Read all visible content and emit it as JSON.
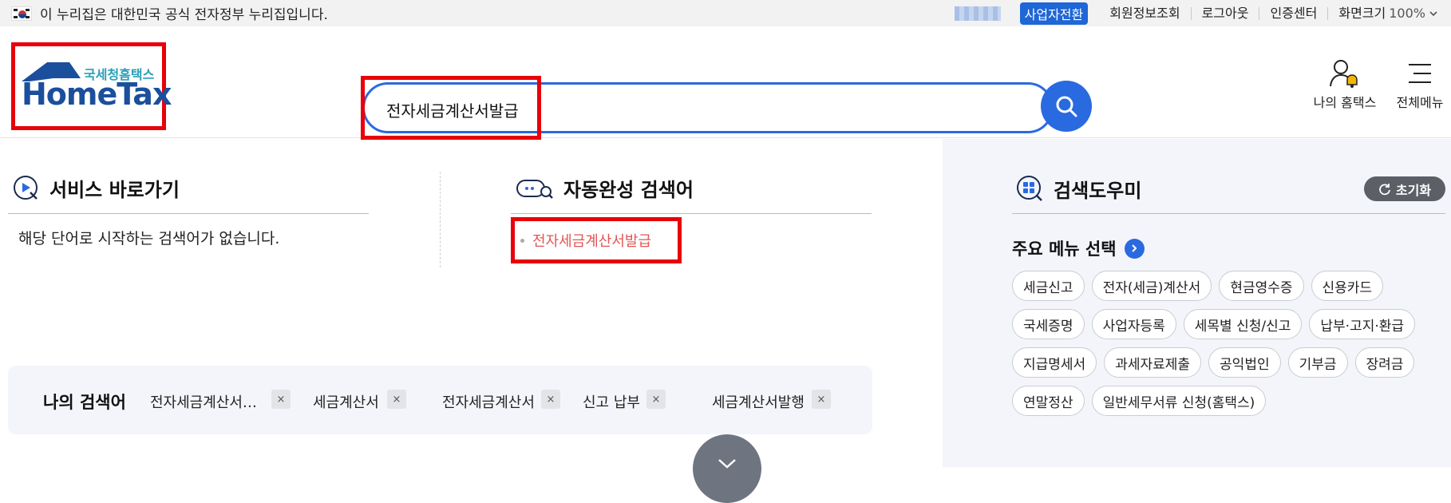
{
  "gov_bar": {
    "notice": "이 누리집은 대한민국 공식 전자정부 누리집입니다.",
    "switch_button": "사업자전환",
    "links": [
      "회원정보조회",
      "로그아웃",
      "인증센터"
    ],
    "zoom_label": "화면크기",
    "zoom_value": "100%"
  },
  "logo": {
    "subtitle": "국세청홈택스",
    "main": "HomeTax"
  },
  "search": {
    "value": "전자세금계산서발급"
  },
  "header_icons": {
    "my_hometax": "나의 홈택스",
    "all_menu": "전체메뉴"
  },
  "service_shortcut": {
    "title": "서비스 바로가기",
    "empty_message": "해당 단어로 시작하는 검색어가 없습니다."
  },
  "autocomplete": {
    "title": "자동완성 검색어",
    "items": [
      "전자세금계산서발급"
    ]
  },
  "my_searches": {
    "label": "나의 검색어",
    "keywords": [
      "전자세금계산서…",
      "세금계산서",
      "전자세금계산서",
      "신고 납부",
      "세금계산서발행"
    ],
    "remove_symbol": "×"
  },
  "help": {
    "title": "검색도우미",
    "reset_label": "초기화",
    "menu_title": "주요 메뉴 선택",
    "chips": [
      "세금신고",
      "전자(세금)계산서",
      "현금영수증",
      "신용카드",
      "국세증명",
      "사업자등록",
      "세목별 신청/신고",
      "납부·고지·환급",
      "지급명세서",
      "과세자료제출",
      "공익법인",
      "기부금",
      "장려금",
      "연말정산",
      "일반세무서류 신청(홈택스)"
    ]
  },
  "colors": {
    "accent": "#2a6ae0",
    "highlight_red": "#e8000a",
    "autocomplete_text": "#e25555"
  }
}
